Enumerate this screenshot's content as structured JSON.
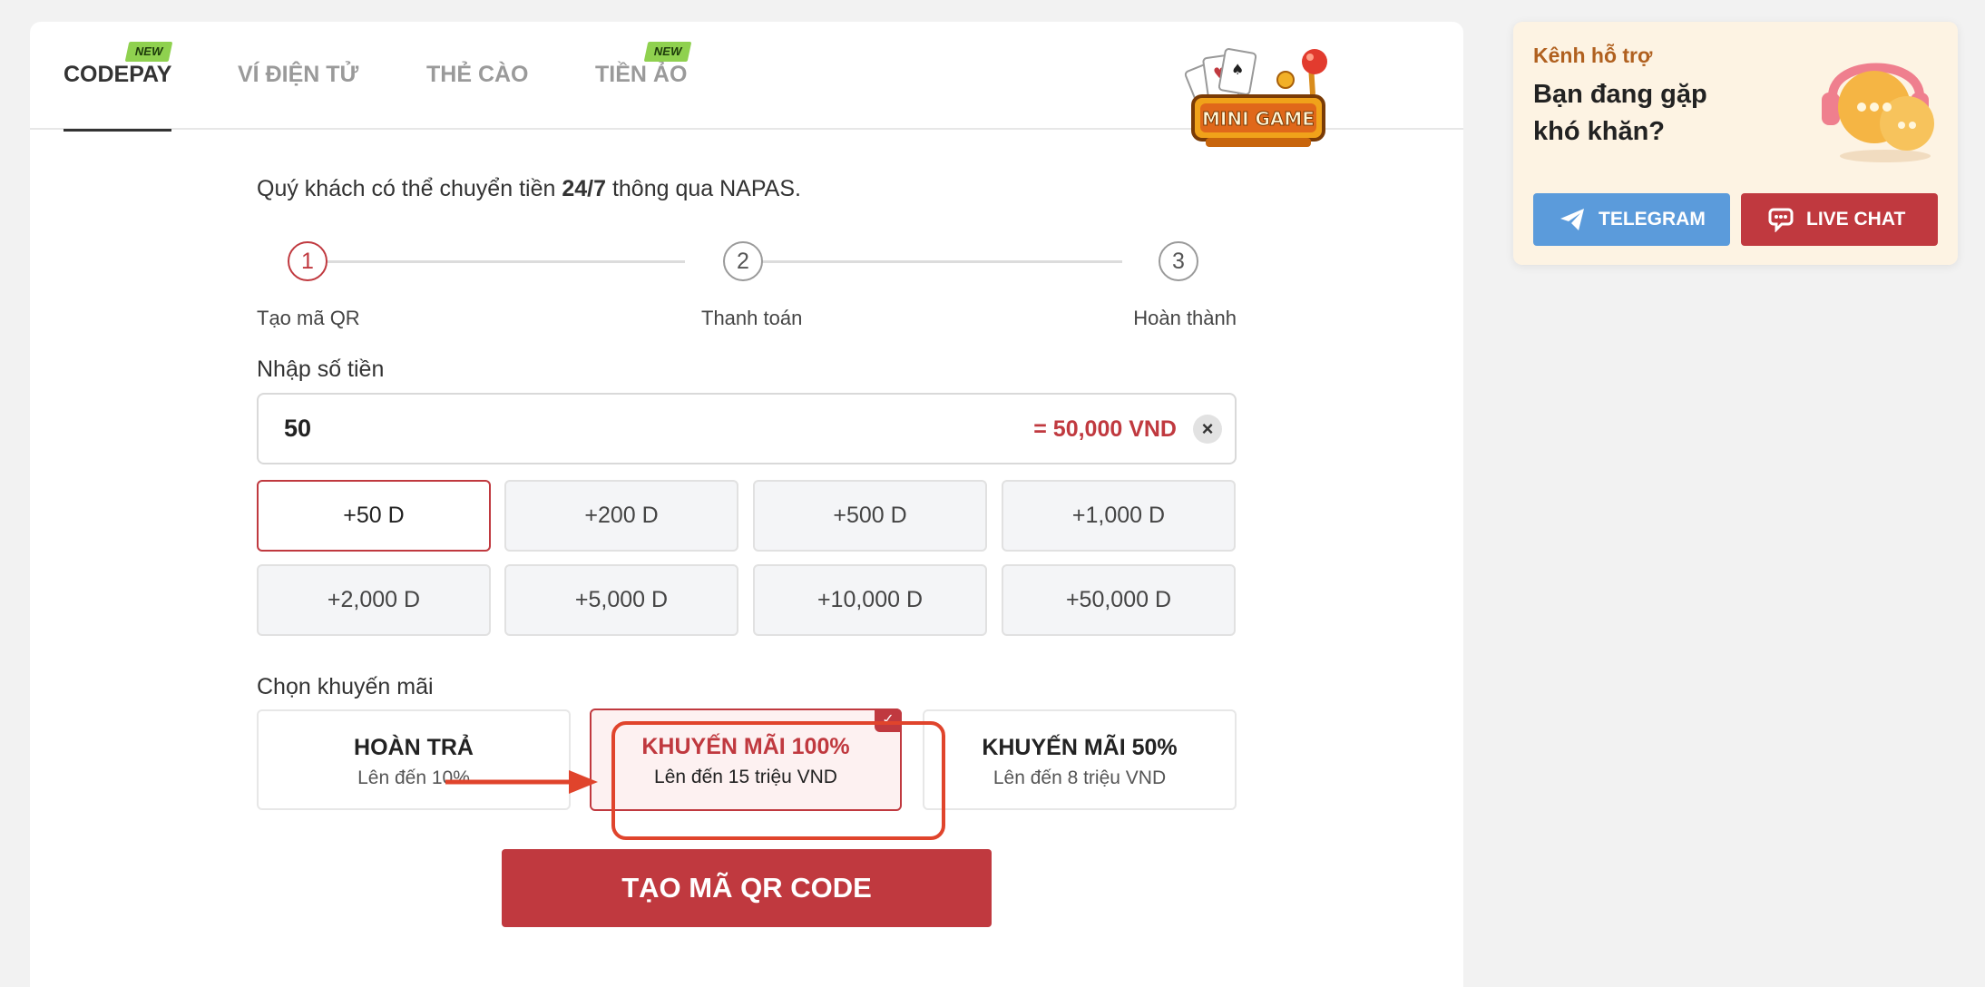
{
  "tabs": [
    {
      "label": "CODEPAY",
      "active": true,
      "badge": "NEW"
    },
    {
      "label": "VÍ ĐIỆN TỬ",
      "active": false
    },
    {
      "label": "THẺ CÀO",
      "active": false
    },
    {
      "label": "TIỀN ẢO",
      "active": false,
      "badge": "NEW"
    }
  ],
  "intro": {
    "before": "Quý khách có thể chuyển tiền ",
    "bold": "24/7",
    "after": " thông qua NAPAS."
  },
  "steps": [
    {
      "number": "1",
      "label": "Tạo mã QR",
      "active": true
    },
    {
      "number": "2",
      "label": "Thanh toán",
      "active": false
    },
    {
      "number": "3",
      "label": "Hoàn thành",
      "active": false
    }
  ],
  "amount": {
    "label": "Nhập số tiền",
    "value": "50",
    "converted": "= 50,000 VND",
    "clear_icon": "close-icon"
  },
  "quick_amounts": [
    "+50 D",
    "+200 D",
    "+500 D",
    "+1,000 D",
    "+2,000 D",
    "+5,000 D",
    "+10,000 D",
    "+50,000 D"
  ],
  "quick_amount_selected": "+50 D",
  "promotion": {
    "label": "Chọn khuyến mãi",
    "options": [
      {
        "title": "HOÀN TRẢ",
        "subtitle": "Lên đến 10%",
        "selected": false
      },
      {
        "title": "KHUYẾN MÃI 100%",
        "subtitle": "Lên đến 15 triệu VND",
        "selected": true
      },
      {
        "title": "KHUYẾN MÃI 50%",
        "subtitle": "Lên đến 8 triệu VND",
        "selected": false
      }
    ]
  },
  "create_button": "TẠO MÃ QR CODE",
  "support": {
    "kicker": "Kênh hỗ trợ",
    "title": "Bạn đang gặp khó khăn?",
    "telegram_label": "TELEGRAM",
    "livechat_label": "LIVE CHAT",
    "telegram_icon": "paper-plane-icon",
    "livechat_icon": "chat-icon"
  },
  "logo_text": "MINI GAME",
  "colors": {
    "brand_red": "#c0393f",
    "highlight": "#e0442c",
    "badge_green": "#8fd14f",
    "telegram_blue": "#5b9bdb",
    "support_bg": "#fdf3e3"
  }
}
